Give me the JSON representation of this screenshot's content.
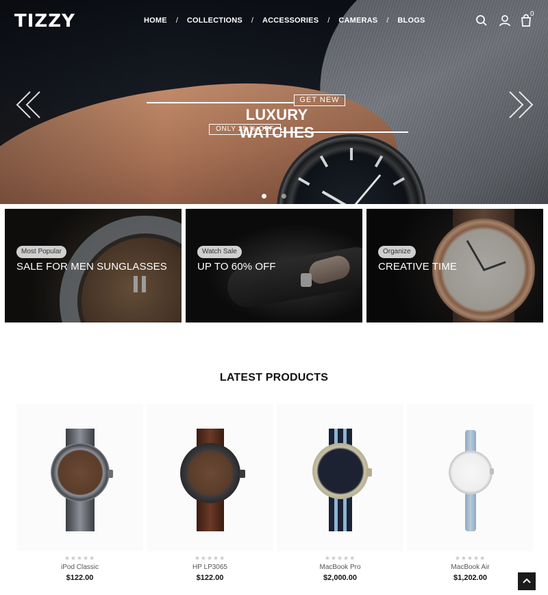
{
  "header": {
    "logo": "TIZZY",
    "nav": [
      {
        "label": "HOME"
      },
      {
        "label": "COLLECTIONS"
      },
      {
        "label": "ACCESSORIES"
      },
      {
        "label": "CAMERAS"
      },
      {
        "label": "BLOGS"
      }
    ],
    "nav_separator": "/",
    "cart_count": "0",
    "icons": [
      "search-icon",
      "user-icon",
      "cart-icon"
    ]
  },
  "hero": {
    "tag": "GET NEW",
    "title": "LUXURY WATCHES",
    "subtitle": "ONLY 25 % OFF",
    "slides": 2,
    "active_slide": 1,
    "arrows": [
      "chevron-left-icon",
      "chevron-right-icon"
    ]
  },
  "banners": [
    {
      "badge": "Most Popular",
      "title": "SALE FOR MEN SUNGLASSES"
    },
    {
      "badge": "Watch Sale",
      "title": "UP TO 60% OFF"
    },
    {
      "badge": "Organize",
      "title": "CREATIVE TIME"
    }
  ],
  "latest": {
    "title": "LATEST PRODUCTS",
    "rating_glyphs": "★★★★★",
    "products": [
      {
        "name": "iPod Classic",
        "price": "$122.00",
        "rating": 0
      },
      {
        "name": "HP LP3065",
        "price": "$122.00",
        "rating": 0
      },
      {
        "name": "MacBook Pro",
        "price": "$2,000.00",
        "rating": 0
      },
      {
        "name": "MacBook Air",
        "price": "$1,202.00",
        "rating": 0
      }
    ]
  },
  "colors": {
    "accent": "#111111",
    "star_empty": "#c9c9c9"
  },
  "back_to_top_icon": "arrow-up-icon"
}
